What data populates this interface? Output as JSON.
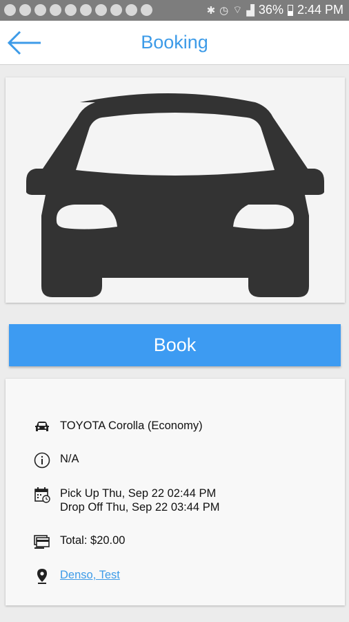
{
  "status_bar": {
    "battery": "36%",
    "time": "2:44 PM"
  },
  "header": {
    "title": "Booking",
    "back_icon": "arrow-left-icon"
  },
  "hero": {
    "image": "car-front-icon"
  },
  "book_button": {
    "label": "Book"
  },
  "details": {
    "vehicle": "TOYOTA Corolla (Economy)",
    "info": "N/A",
    "pickup": "Pick Up Thu, Sep 22 02:44 PM",
    "dropoff": "Drop Off Thu, Sep 22 03:44 PM",
    "total": "Total: $20.00",
    "location": "Denso, Test"
  },
  "colors": {
    "accent": "#3d9be8",
    "button": "#3d9bf2",
    "car": "#333333"
  }
}
